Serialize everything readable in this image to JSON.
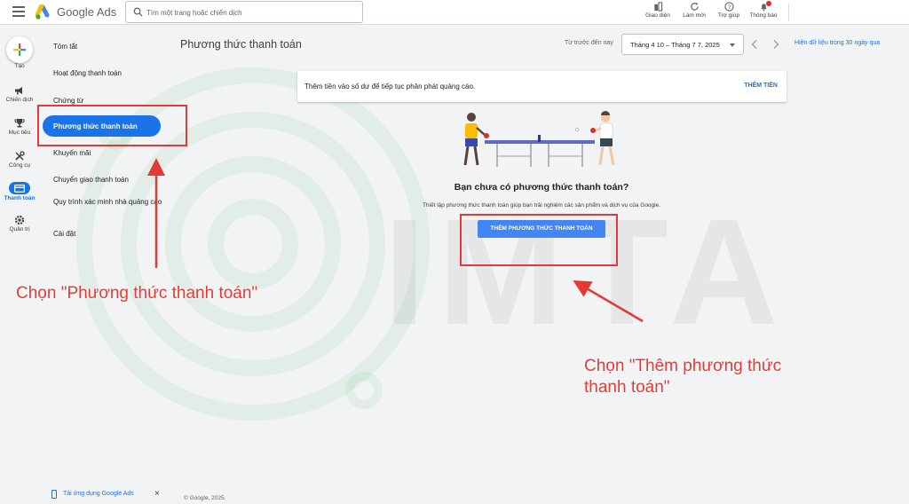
{
  "app": {
    "brand": "Google Ads"
  },
  "search": {
    "placeholder": "Tìm một trang hoặc chiến dịch",
    "value": ""
  },
  "top_actions": [
    {
      "label": "Giao diện",
      "icon": "appearance-icon"
    },
    {
      "label": "Làm mới",
      "icon": "refresh-icon"
    },
    {
      "label": "Trợ giúp",
      "icon": "help-icon"
    },
    {
      "label": "Thông báo",
      "icon": "bell-icon"
    }
  ],
  "rail": {
    "create_label": "Tạo",
    "items": [
      {
        "label": "Chiến dịch",
        "icon": "megaphone-icon"
      },
      {
        "label": "Mục tiêu",
        "icon": "trophy-icon"
      },
      {
        "label": "Công cụ",
        "icon": "tools-icon"
      },
      {
        "label": "Thanh toán",
        "icon": "credit-card-icon",
        "active": true
      },
      {
        "label": "Quản trị",
        "icon": "gear-icon"
      }
    ]
  },
  "subnav": {
    "items": [
      {
        "label": "Tóm tắt"
      },
      {
        "label": "Hoạt động thanh toán"
      },
      {
        "label": "Chứng từ"
      },
      {
        "label": "Phương thức thanh toán",
        "active": true
      },
      {
        "label": "Khuyến mãi"
      },
      {
        "label": "Chuyển giao thanh toán"
      },
      {
        "label": "Quy trình xác minh nhà quảng cáo"
      },
      {
        "label": "Cài đặt"
      }
    ],
    "promo": "Tải ứng dụng Google Ads",
    "promo_close": "×"
  },
  "footer": "© Google, 2025.",
  "header": {
    "title": "Phương thức thanh toán",
    "range_label": "Từ trước đến nay",
    "date_range": "Tháng 4 10 – Tháng 7 7, 2025",
    "last30": "Hiện dữ liệu trong 30 ngày qua"
  },
  "banner": {
    "message": "Thêm tiền vào số dư để tiếp tục phân phát quảng cáo.",
    "action": "THÊM TIỀN"
  },
  "empty_state": {
    "title": "Bạn chưa có phương thức thanh toán?",
    "description": "Thiết lập phương thức thanh toán giúp bạn trải nghiệm các sản phẩm và dịch vụ của Google.",
    "button": "THÊM PHƯƠNG THỨC THANH TOÁN"
  },
  "annotations": {
    "left": "Chọn \"Phương thức thanh toán\"",
    "right_line1": "Chọn \"Thêm phương thức",
    "right_line2": "thanh toán\"",
    "color": "#e53935"
  },
  "watermark": "IMTA",
  "colors": {
    "accent": "#1a73e8",
    "button": "#4285f4",
    "annotation": "#e53935"
  }
}
